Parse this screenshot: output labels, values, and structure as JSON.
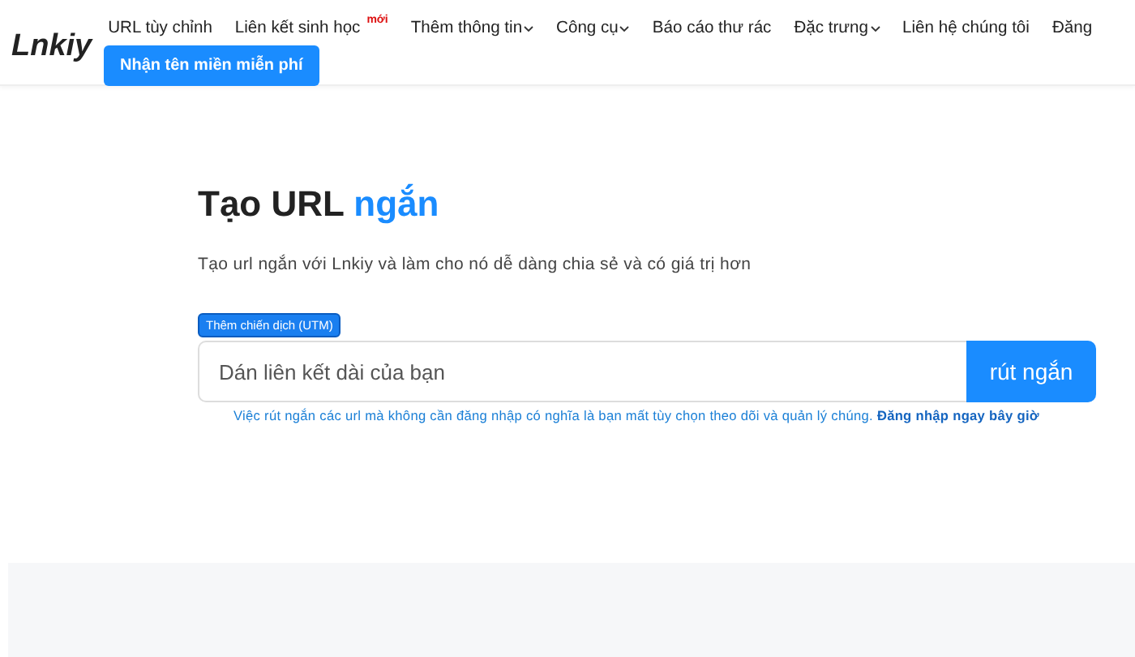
{
  "header": {
    "logo": "Lnkiy",
    "cta": "Nhận tên miền miễn phí",
    "nav": [
      {
        "label": "URL tùy chỉnh",
        "has_menu": false
      },
      {
        "label": "Liên kết sinh học",
        "has_menu": false,
        "badge": "mới"
      },
      {
        "label": "Thêm thông tin",
        "has_menu": true
      },
      {
        "label": "Công cụ",
        "has_menu": true
      },
      {
        "label": "Báo cáo thư rác",
        "has_menu": false
      },
      {
        "label": "Đặc trưng",
        "has_menu": true
      },
      {
        "label": "Liên hệ chúng tôi",
        "has_menu": false
      },
      {
        "label": "Đăng",
        "has_menu": false
      }
    ]
  },
  "hero": {
    "title": "Tạo URL",
    "title_accent": "ngắn",
    "subtitle": "Tạo url ngắn với Lnkiy và làm cho nó dễ dàng chia sẻ và có giá trị hơn",
    "utm_button": "Thêm chiến dịch (UTM)",
    "placeholder": "Dán liên kết dài của bạn",
    "submit": "rút ngắn",
    "note": "Việc rút ngắn các url mà không cần đăng nhập có nghĩa là bạn mất tùy chọn theo dõi và quản lý chúng.",
    "note_link": "Đăng nhập ngay bây giờ"
  }
}
